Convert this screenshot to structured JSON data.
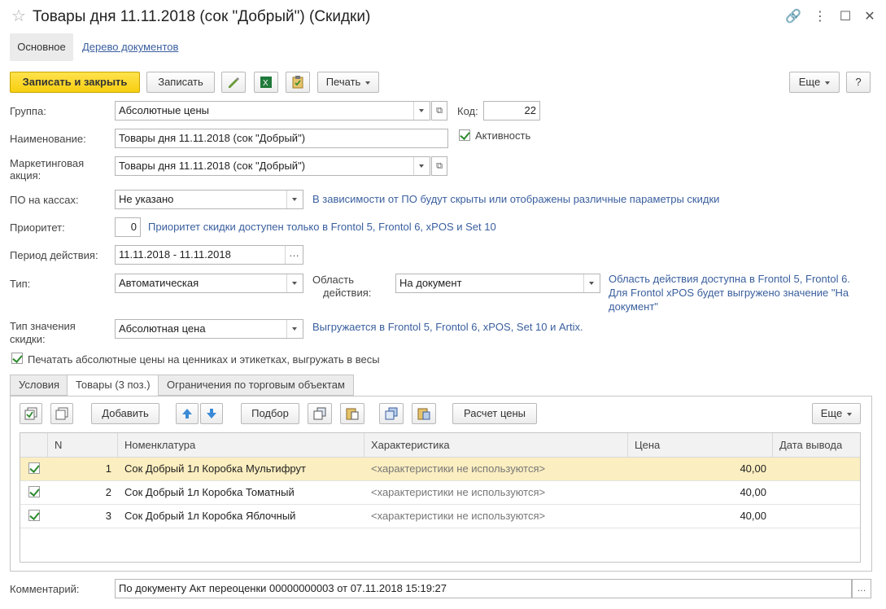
{
  "window": {
    "title": "Товары дня 11.11.2018 (сок \"Добрый\") (Скидки)",
    "icons": [
      "star-icon",
      "link-icon",
      "more-icon",
      "maximize-icon",
      "close-icon"
    ]
  },
  "sections": {
    "main": "Основное",
    "doc_tree": "Дерево документов"
  },
  "toolbar": {
    "save_close": "Записать и закрыть",
    "save": "Записать",
    "print": "Печать",
    "more": "Еще",
    "help": "?"
  },
  "form": {
    "group_label": "Группа:",
    "group_value": "Абсолютные цены",
    "code_label": "Код:",
    "code_value": "22",
    "name_label": "Наименование:",
    "name_value": "Товары дня 11.11.2018 (сок \"Добрый\")",
    "active_label": "Активность",
    "promo_label_1": "Маркетинговая",
    "promo_label_2": "акция:",
    "promo_value": "Товары дня 11.11.2018 (сок \"Добрый\")",
    "pos_label": "ПО на кассах:",
    "pos_value": "Не указано",
    "pos_hint": "В зависимости от ПО будут скрыты или отображены различные параметры скидки",
    "priority_label": "Приоритет:",
    "priority_value": "0",
    "priority_hint": "Приоритет скидки доступен только в Frontol 5, Frontol 6, xPOS и Set 10",
    "period_label": "Период действия:",
    "period_value": "11.11.2018 - 11.11.2018",
    "type_label": "Тип:",
    "type_value": "Автоматическая",
    "scope_label_1": "Область",
    "scope_label_2": "действия:",
    "scope_value": "На документ",
    "scope_hint_1": "Область действия доступна в Frontol 5, Frontol 6.",
    "scope_hint_2": "Для Frontol xPOS будет выгружено значение \"На",
    "scope_hint_3": "документ\"",
    "value_type_label_1": "Тип значения",
    "value_type_label_2": "скидки:",
    "value_type_value": "Абсолютная цена",
    "value_type_hint": "Выгружается в Frontol 5, Frontol 6, xPOS, Set 10 и Artix.",
    "print_abs_label": "Печатать абсолютные цены на ценниках и этикетках, выгружать в весы",
    "comment_label": "Комментарий:",
    "comment_value": "По документу Акт переоценки 00000000003 от 07.11.2018 15:19:27"
  },
  "tabs": [
    {
      "label": "Условия"
    },
    {
      "label": "Товары (3 поз.)"
    },
    {
      "label": "Ограничения по торговым объектам"
    }
  ],
  "table_toolbar": {
    "add": "Добавить",
    "selection": "Подбор",
    "calc_price": "Расчет цены",
    "more": "Еще"
  },
  "table": {
    "columns": [
      "N",
      "Номенклатура",
      "Характеристика",
      "Цена",
      "Дата вывода"
    ],
    "rows": [
      {
        "n": "1",
        "item": "Сок Добрый 1л Коробка Мультифрут",
        "characteristic": "<характеристики не используются>",
        "price": "40,00",
        "date": ""
      },
      {
        "n": "2",
        "item": "Сок Добрый 1л Коробка Томатный",
        "characteristic": "<характеристики не используются>",
        "price": "40,00",
        "date": ""
      },
      {
        "n": "3",
        "item": "Сок Добрый 1л Коробка Яблочный",
        "characteristic": "<характеристики не используются>",
        "price": "40,00",
        "date": ""
      }
    ]
  },
  "colors": {
    "primary_button": "#f7cf0f",
    "link": "#3a5f9e",
    "selected_row": "#fbeec0",
    "check": "#2e8b2e"
  }
}
